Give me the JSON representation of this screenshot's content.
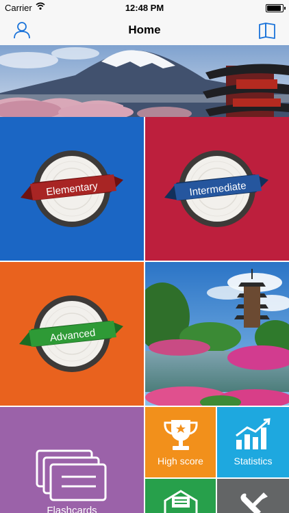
{
  "status_bar": {
    "carrier": "Carrier",
    "time": "12:48 PM"
  },
  "navbar": {
    "title": "Home"
  },
  "tiles": {
    "elementary": "Elementary",
    "intermediate": "Intermediate",
    "advanced": "Advanced",
    "flashcards": "Flashcards",
    "high_score": "High score",
    "statistics": "Statistics"
  },
  "colors": {
    "elementary_bg": "#1b66c4",
    "intermediate_bg": "#bd1f3d",
    "advanced_bg": "#e9621e",
    "flashcards_bg": "#9b62a9",
    "high_score_bg": "#f2901b",
    "statistics_bg": "#1ea8df",
    "mail_bg": "#27a04b",
    "tools_bg": "#636566",
    "accent": "#1a73d9"
  },
  "icons": [
    "wifi-icon",
    "battery-icon",
    "profile-icon",
    "book-icon",
    "trophy-icon",
    "bar-chart-icon",
    "flashcards-icon",
    "envelope-icon",
    "wrench-screwdriver-icon"
  ]
}
